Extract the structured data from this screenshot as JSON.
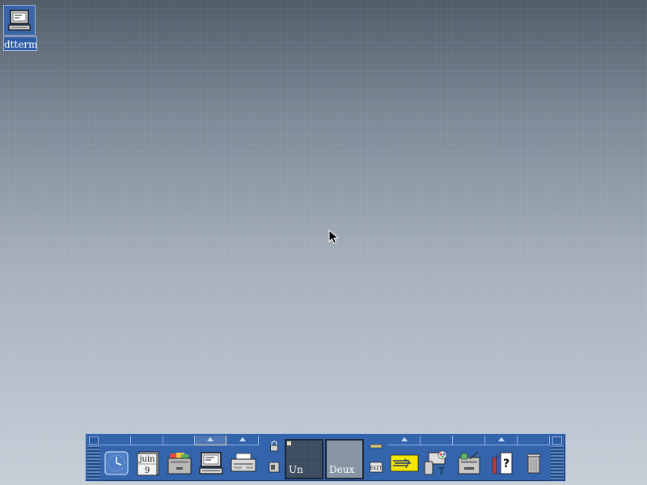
{
  "desktop": {
    "icon_label": "dtterm"
  },
  "panel": {
    "calendar": {
      "month": "juin",
      "day": "9"
    },
    "workspaces": [
      {
        "label": "Un"
      },
      {
        "label": "Deux"
      }
    ],
    "exit_label": "EXIT",
    "colors": {
      "panel": "#3464ab",
      "highlight": "#a9c0e2",
      "accent_yellow": "#f4e600"
    },
    "icons": [
      "clock-icon",
      "calendar-icon",
      "file-manager-icon",
      "terminal-icon",
      "printer-icon",
      "lock-icon",
      "busy-indicator-icon",
      "exit-icon",
      "mailer-icon",
      "style-manager-icon",
      "application-manager-icon",
      "help-manager-icon",
      "trash-icon"
    ]
  }
}
